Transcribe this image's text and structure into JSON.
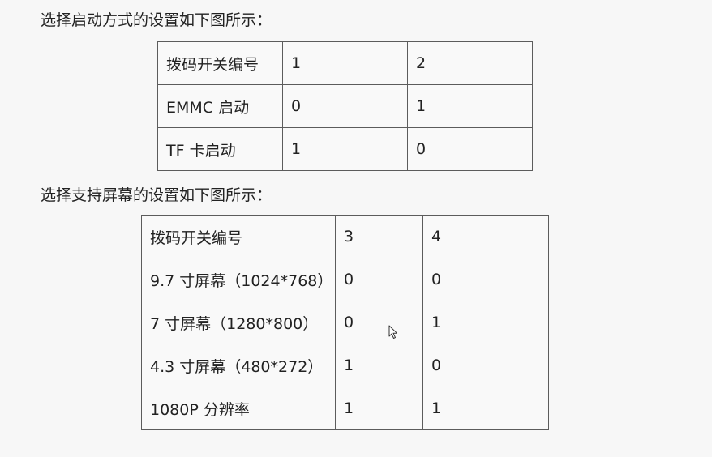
{
  "boot_section": {
    "heading": "选择启动方式的设置如下图所示：",
    "table": {
      "header": [
        "拨码开关编号",
        "1",
        "2"
      ],
      "rows": [
        [
          "EMMC 启动",
          "0",
          "1"
        ],
        [
          "TF 卡启动",
          "1",
          "0"
        ]
      ]
    }
  },
  "screen_section": {
    "heading": "选择支持屏幕的设置如下图所示：",
    "table": {
      "header": [
        "拨码开关编号",
        "3",
        "4"
      ],
      "rows": [
        [
          "9.7 寸屏幕（1024*768）",
          "0",
          "0"
        ],
        [
          "7 寸屏幕（1280*800）",
          "0",
          "1"
        ],
        [
          "4.3 寸屏幕（480*272）",
          "1",
          "0"
        ],
        [
          "1080P 分辨率",
          "1",
          "1"
        ]
      ]
    }
  },
  "cursor_icon": "mouse-pointer-icon"
}
